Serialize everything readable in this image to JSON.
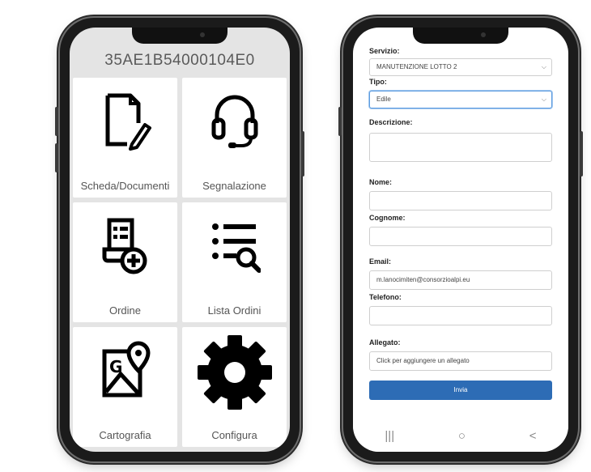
{
  "home": {
    "device_id": "35AE1B54000104E0",
    "tiles": [
      {
        "label": "Scheda/Documenti",
        "icon": "document-edit-icon"
      },
      {
        "label": "Segnalazione",
        "icon": "headset-icon"
      },
      {
        "label": "Ordine",
        "icon": "order-add-icon"
      },
      {
        "label": "Lista Ordini",
        "icon": "list-search-icon"
      },
      {
        "label": "Cartografia",
        "icon": "map-pin-icon"
      },
      {
        "label": "Configura",
        "icon": "gear-icon"
      }
    ]
  },
  "form": {
    "servizio_label": "Servizio:",
    "servizio_value": "MANUTENZIONE LOTTO 2",
    "tipo_label": "Tipo:",
    "tipo_value": "Edile",
    "descrizione_label": "Descrizione:",
    "descrizione_value": "",
    "nome_label": "Nome:",
    "nome_value": "",
    "cognome_label": "Cognome:",
    "cognome_value": "",
    "email_label": "Email:",
    "email_value": "m.lanocimiten@consorzioalpi.eu",
    "telefono_label": "Telefono:",
    "telefono_value": "",
    "allegato_label": "Allegato:",
    "allegato_value": "Click per aggiungere un allegato",
    "submit_label": "Invia"
  },
  "navbar": {
    "recent": "|||",
    "home": "○",
    "back": "<"
  },
  "colors": {
    "submit_button": "#2d6cb5",
    "focus_border": "#5b9be0",
    "tile_background": "#ffffff",
    "screen_background": "#e4e4e4"
  }
}
